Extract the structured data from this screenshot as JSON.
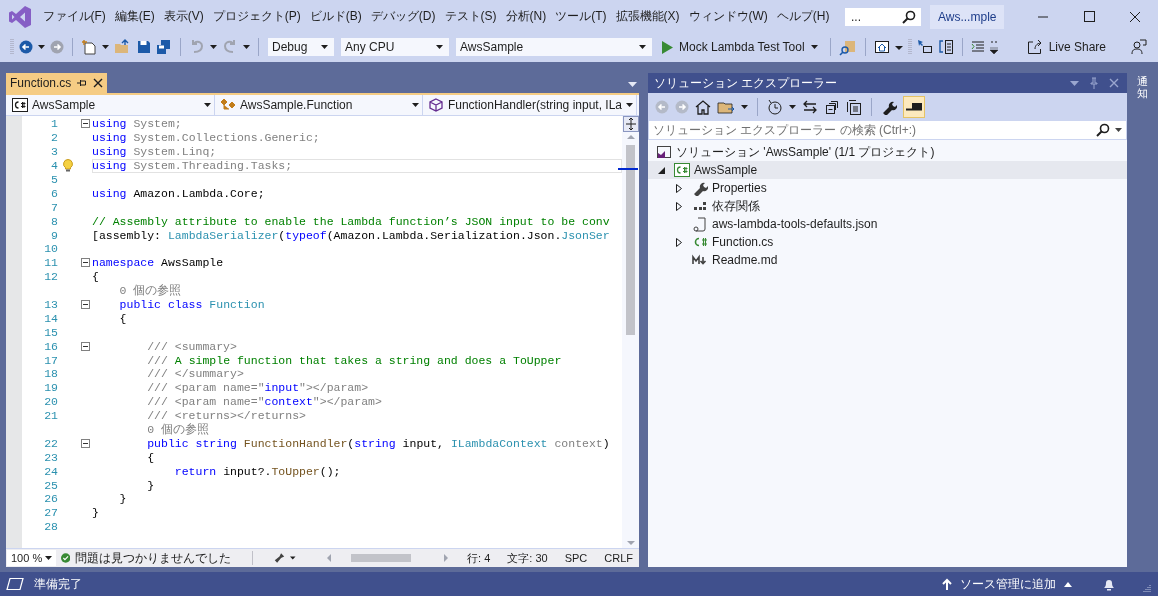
{
  "menu": [
    "ファイル(F)",
    "編集(E)",
    "表示(V)",
    "プロジェクト(P)",
    "ビルド(B)",
    "デバッグ(D)",
    "テスト(S)",
    "分析(N)",
    "ツール(T)",
    "拡張機能(X)",
    "ウィンドウ(W)",
    "ヘルプ(H)"
  ],
  "search": {
    "placeholder": "..."
  },
  "solution_badge": "Aws...mple",
  "toolbar": {
    "configuration": "Debug",
    "platform": "Any CPU",
    "startup_project": "AwsSample",
    "run_target": "Mock Lambda Test Tool",
    "live_share": "Live Share"
  },
  "editor": {
    "tab": {
      "label": "Function.cs",
      "selected": true
    },
    "nav": [
      "AwsSample",
      "AwsSample.Function",
      "FunctionHandler(string input, ILa"
    ],
    "lines": [
      {
        "kind": "code",
        "number": "1",
        "fold": true,
        "current": false,
        "tokens": [
          {
            "kind": "kw",
            "text": "using"
          },
          {
            "kind": "dim",
            "text": " System;"
          }
        ]
      },
      {
        "kind": "code",
        "number": "2",
        "fold": false,
        "current": false,
        "tokens": [
          {
            "kind": "kw",
            "text": "using"
          },
          {
            "kind": "dim",
            "text": " System.Collections.Generic;"
          }
        ]
      },
      {
        "kind": "code",
        "number": "3",
        "fold": false,
        "current": false,
        "tokens": [
          {
            "kind": "kw",
            "text": "using"
          },
          {
            "kind": "dim",
            "text": " System.Linq;"
          }
        ]
      },
      {
        "kind": "code",
        "number": "4",
        "fold": false,
        "current": true,
        "tokens": [
          {
            "kind": "kw",
            "text": "using"
          },
          {
            "kind": "dim",
            "text": " System.Threading.Tasks;"
          }
        ]
      },
      {
        "kind": "code",
        "number": "5",
        "fold": false,
        "current": false
      },
      {
        "kind": "code",
        "number": "6",
        "fold": false,
        "current": false,
        "tokens": [
          {
            "kind": "kw",
            "text": "using"
          },
          {
            "kind": "plain",
            "text": " Amazon.Lambda.Core;"
          }
        ]
      },
      {
        "kind": "code",
        "number": "7",
        "fold": false,
        "current": false
      },
      {
        "kind": "code",
        "number": "8",
        "fold": false,
        "current": false,
        "tokens": [
          {
            "kind": "comment",
            "text": "// Assembly attribute to enable the Lambda function’s JSON input to be conv"
          }
        ]
      },
      {
        "kind": "code",
        "number": "9",
        "fold": false,
        "current": false,
        "tokens": [
          {
            "kind": "plain",
            "text": "[assembly: "
          },
          {
            "kind": "type",
            "text": "LambdaSerializer"
          },
          {
            "kind": "plain",
            "text": "("
          },
          {
            "kind": "kw",
            "text": "typeof"
          },
          {
            "kind": "plain",
            "text": "(Amazon.Lambda.Serialization.Json."
          },
          {
            "kind": "type",
            "text": "JsonSer"
          }
        ]
      },
      {
        "kind": "code",
        "number": "10",
        "fold": false,
        "current": false
      },
      {
        "kind": "code",
        "number": "11",
        "fold": true,
        "current": false,
        "tokens": [
          {
            "kind": "kw",
            "text": "namespace"
          },
          {
            "kind": "plain",
            "text": " AwsSample"
          }
        ]
      },
      {
        "kind": "code",
        "number": "12",
        "fold": false,
        "current": false,
        "tokens": [
          {
            "kind": "plain",
            "text": "{"
          }
        ]
      },
      {
        "kind": "codelens",
        "text": "    0 個の参照"
      },
      {
        "kind": "code",
        "number": "13",
        "fold": true,
        "current": false,
        "tokens": [
          {
            "kind": "kw",
            "text": "    public class"
          },
          {
            "kind": "type",
            "text": " Function"
          }
        ]
      },
      {
        "kind": "code",
        "number": "14",
        "fold": false,
        "current": false,
        "tokens": [
          {
            "kind": "plain",
            "text": "    {"
          }
        ]
      },
      {
        "kind": "code",
        "number": "15",
        "fold": false,
        "current": false
      },
      {
        "kind": "code",
        "number": "16",
        "fold": true,
        "current": false,
        "tokens": [
          {
            "kind": "doc",
            "text": "        /// <summary>"
          }
        ]
      },
      {
        "kind": "code",
        "number": "17",
        "fold": false,
        "current": false,
        "tokens": [
          {
            "kind": "doc",
            "text": "        ///"
          },
          {
            "kind": "comment",
            "text": " A simple function that takes a string and does a ToUpper"
          }
        ]
      },
      {
        "kind": "code",
        "number": "18",
        "fold": false,
        "current": false,
        "tokens": [
          {
            "kind": "doc",
            "text": "        /// </summary>"
          }
        ]
      },
      {
        "kind": "code",
        "number": "19",
        "fold": false,
        "current": false,
        "tokens": [
          {
            "kind": "doc",
            "text": "        /// <param name=\""
          },
          {
            "kind": "param_name",
            "text": "input"
          },
          {
            "kind": "doc",
            "text": "\"></param>"
          }
        ]
      },
      {
        "kind": "code",
        "number": "20",
        "fold": false,
        "current": false,
        "tokens": [
          {
            "kind": "doc",
            "text": "        /// <param name=\""
          },
          {
            "kind": "param_name",
            "text": "context"
          },
          {
            "kind": "doc",
            "text": "\"></param>"
          }
        ]
      },
      {
        "kind": "code",
        "number": "21",
        "fold": false,
        "current": false,
        "tokens": [
          {
            "kind": "doc",
            "text": "        /// <returns></returns>"
          }
        ]
      },
      {
        "kind": "codelens",
        "text": "        0 個の参照"
      },
      {
        "kind": "code",
        "number": "22",
        "fold": true,
        "current": false,
        "tokens": [
          {
            "kind": "kw",
            "text": "        public string"
          },
          {
            "kind": "method",
            "text": " FunctionHandler"
          },
          {
            "kind": "plain",
            "text": "("
          },
          {
            "kind": "kw",
            "text": "string"
          },
          {
            "kind": "plain",
            "text": " input, "
          },
          {
            "kind": "type",
            "text": "ILambdaContext"
          },
          {
            "kind": "dim",
            "text": " context"
          },
          {
            "kind": "plain",
            "text": ")"
          }
        ]
      },
      {
        "kind": "code",
        "number": "23",
        "fold": false,
        "current": false,
        "tokens": [
          {
            "kind": "plain",
            "text": "        {"
          }
        ]
      },
      {
        "kind": "code",
        "number": "24",
        "fold": false,
        "current": false,
        "tokens": [
          {
            "kind": "kw",
            "text": "            return"
          },
          {
            "kind": "plain",
            "text": " input?."
          },
          {
            "kind": "method",
            "text": "ToUpper"
          },
          {
            "kind": "plain",
            "text": "();"
          }
        ]
      },
      {
        "kind": "code",
        "number": "25",
        "fold": false,
        "current": false,
        "tokens": [
          {
            "kind": "plain",
            "text": "        }"
          }
        ]
      },
      {
        "kind": "code",
        "number": "26",
        "fold": false,
        "current": false,
        "tokens": [
          {
            "kind": "plain",
            "text": "    }"
          }
        ]
      },
      {
        "kind": "code",
        "number": "27",
        "fold": false,
        "current": false,
        "tokens": [
          {
            "kind": "plain",
            "text": "}"
          }
        ]
      },
      {
        "kind": "code",
        "number": "28",
        "fold": false,
        "current": false
      }
    ],
    "status": {
      "zoom": "100 %",
      "issues": "問題は見つかりませんでした",
      "line": "行: 4",
      "column": "文字: 30",
      "whitespace": "SPC",
      "line_ending": "CRLF"
    }
  },
  "solution_explorer": {
    "title": "ソリューション エクスプローラー",
    "preview_toggle": {
      "on": true
    },
    "search": {
      "placeholder": "ソリューション エクスプローラー の検索 (Ctrl+:)"
    },
    "tree": [
      {
        "label": "ソリューション 'AwsSample' (1/1 プロジェクト)",
        "kind": "solution",
        "selected": false,
        "children": [
          {
            "label": "AwsSample",
            "kind": "project",
            "selected": true,
            "expandable": true,
            "expanded": true,
            "children": [
              {
                "label": "Properties",
                "kind": "properties",
                "selected": false,
                "expandable": true,
                "expanded": false
              },
              {
                "label": "依存関係",
                "kind": "dependencies",
                "selected": false,
                "expandable": true,
                "expanded": false
              },
              {
                "label": "aws-lambda-tools-defaults.json",
                "kind": "json",
                "selected": false,
                "expandable": false
              },
              {
                "label": "Function.cs",
                "kind": "csharp",
                "selected": false,
                "expandable": true,
                "expanded": false
              },
              {
                "label": "Readme.md",
                "kind": "markdown",
                "selected": false,
                "expandable": false
              }
            ]
          }
        ]
      }
    ]
  },
  "notifications_tab": "通知",
  "status_bar": {
    "message": "準備完了",
    "source_control": "ソース管理に追加"
  }
}
